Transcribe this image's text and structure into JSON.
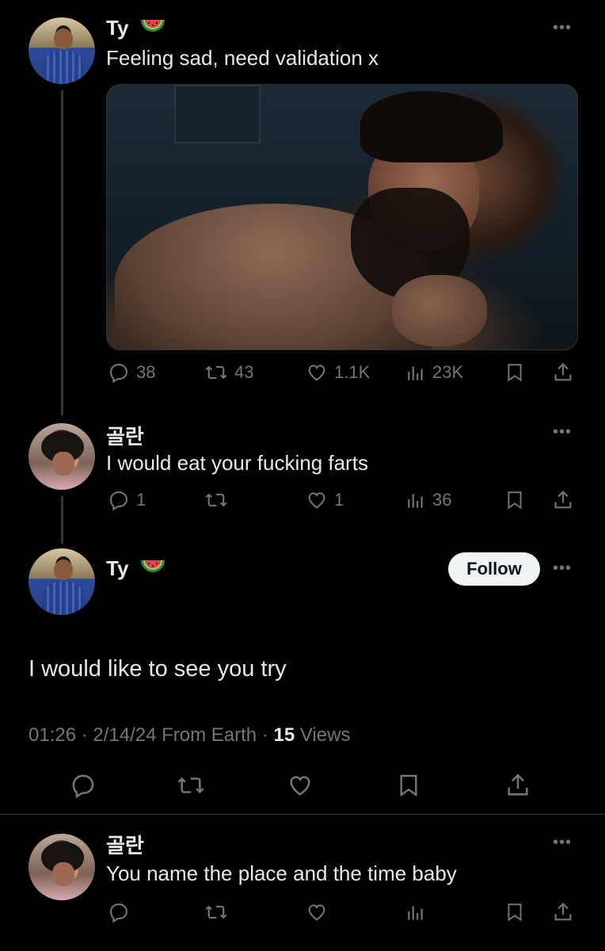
{
  "tweet1": {
    "author": "Ty",
    "text": "Feeling sad, need validation x",
    "stats": {
      "replies": "38",
      "reposts": "43",
      "likes": "1.1K",
      "views": "23K"
    }
  },
  "reply1": {
    "author": "골란",
    "text": "I would eat your fucking farts",
    "stats": {
      "replies": "1",
      "reposts": "",
      "likes": "1",
      "views": "36"
    }
  },
  "focus": {
    "author": "Ty",
    "follow_label": "Follow",
    "text": "I would like to see you try",
    "meta_prefix": "01:26 · 2/14/24 From Earth · ",
    "views_count": "15",
    "views_label": " Views"
  },
  "reply2": {
    "author": "골란",
    "text": "You name the place and the time baby"
  },
  "icons": {
    "author_emoji": "watermelon-icon",
    "more": "more-icon",
    "reply": "reply-icon",
    "repost": "repost-icon",
    "like": "like-icon",
    "views": "views-icon",
    "bookmark": "bookmark-icon",
    "share": "share-icon"
  }
}
